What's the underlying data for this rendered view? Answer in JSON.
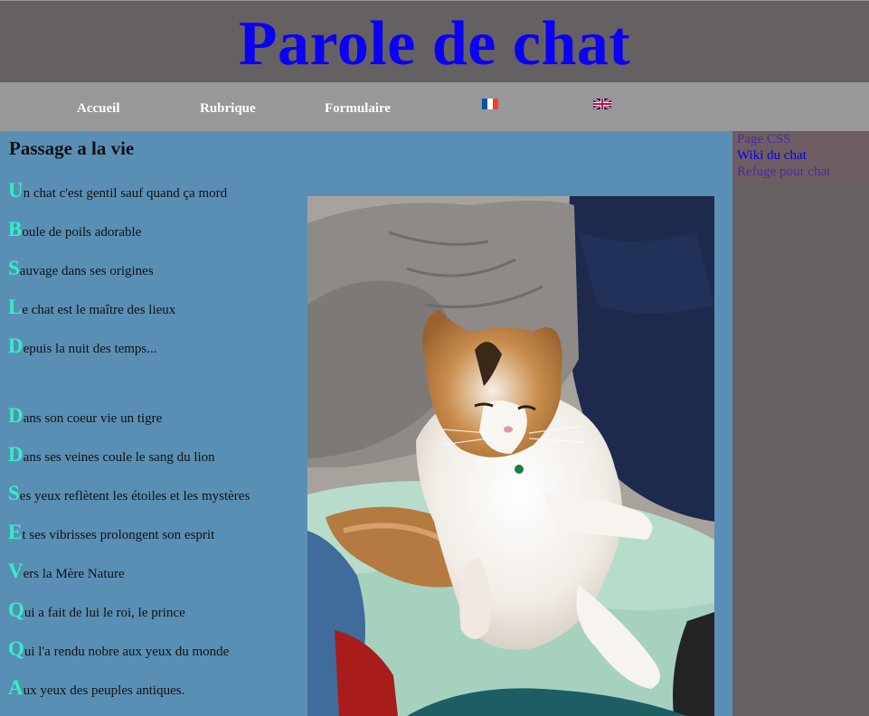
{
  "header": {
    "title": "Parole de chat"
  },
  "nav": {
    "items": [
      {
        "label": "Accueil"
      },
      {
        "label": "Rubrique"
      },
      {
        "label": "Formulaire"
      }
    ],
    "flags": [
      "french-flag-icon",
      "uk-flag-icon"
    ]
  },
  "main": {
    "heading": "Passage a la vie",
    "poem": [
      {
        "cap": "U",
        "rest": "n chat c'est gentil sauf quand ça mord"
      },
      {
        "cap": "B",
        "rest": "oule de poils adorable"
      },
      {
        "cap": "S",
        "rest": "auvage dans ses origines"
      },
      {
        "cap": "L",
        "rest": "e chat est le maître des lieux"
      },
      {
        "cap": "D",
        "rest": "epuis la nuit des temps..."
      },
      {
        "cap": "D",
        "rest": "ans son coeur vie un tigre"
      },
      {
        "cap": "D",
        "rest": "ans ses veines coule le sang du lion"
      },
      {
        "cap": "S",
        "rest": "es yeux reflètent les étoiles et les mystères"
      },
      {
        "cap": "E",
        "rest": "t ses vibrisses prolongent son esprit"
      },
      {
        "cap": "V",
        "rest": "ers la Mère Nature"
      },
      {
        "cap": "Q",
        "rest": "ui a fait de lui le roi, le prince"
      },
      {
        "cap": "Q",
        "rest": "ui l'a rendu nobre aux yeux du monde"
      },
      {
        "cap": "A",
        "rest": "ux yeux des peuples antiques."
      }
    ]
  },
  "sidebar": {
    "links": [
      {
        "label": "Page CSS"
      },
      {
        "label": "Wiki du chat"
      },
      {
        "label": "Refuge pour chat"
      }
    ]
  },
  "colors": {
    "title": "#0b00f5",
    "header_bg": "#656162",
    "nav_bg": "#989898",
    "content_bg": "#5a8fb5",
    "dropcap": "#32f0c4"
  }
}
